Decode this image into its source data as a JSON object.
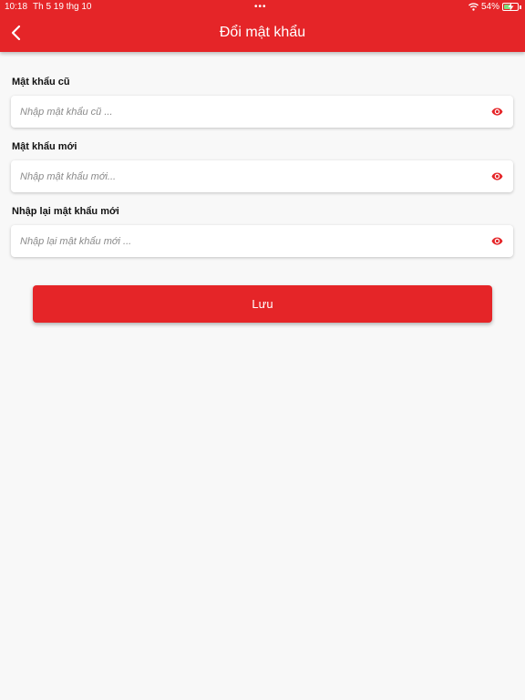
{
  "status_bar": {
    "time": "10:18",
    "date": "Th 5 19 thg 10",
    "multitask_indicator": "•••",
    "battery_percent": "54%",
    "battery_level": 0.54,
    "icons": [
      "wifi-icon",
      "battery-icon",
      "charging-icon"
    ]
  },
  "header": {
    "title": "Đổi mật khẩu",
    "back_icon": "chevron-left-icon",
    "background_color": "#e52528"
  },
  "form": {
    "fields": [
      {
        "label": "Mật khẩu cũ",
        "placeholder": "Nhập mật khẩu cũ ...",
        "value": "",
        "icon": "eye-icon"
      },
      {
        "label": "Mật khẩu mới",
        "placeholder": "Nhập mật khẩu mới...",
        "value": "",
        "icon": "eye-icon"
      },
      {
        "label": "Nhập lại mật khẩu mới",
        "placeholder": "Nhập lại mật khẩu mới ...",
        "value": "",
        "icon": "eye-icon"
      }
    ],
    "save_label": "Lưu"
  },
  "colors": {
    "accent": "#e52528",
    "background": "#f8f8f8"
  }
}
